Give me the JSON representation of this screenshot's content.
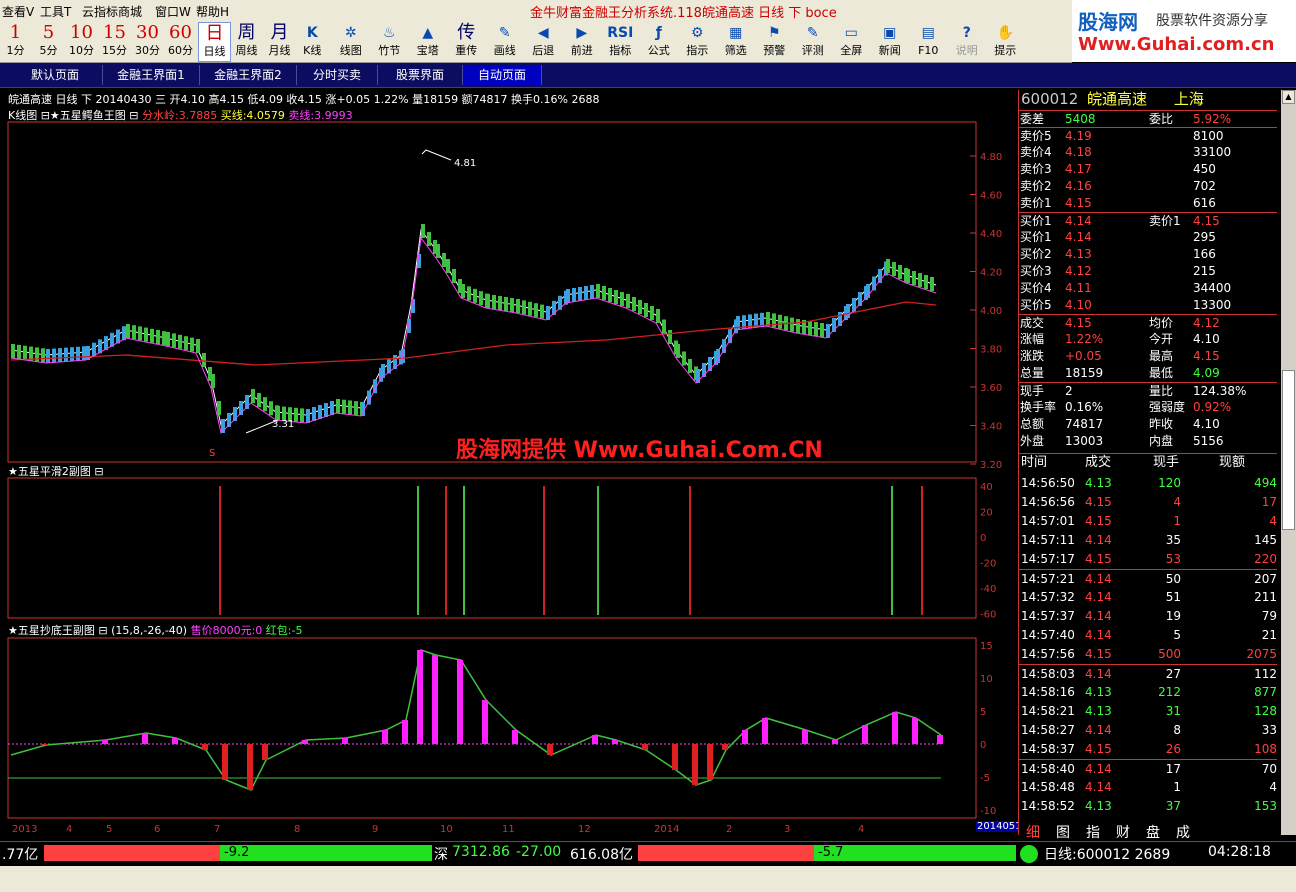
{
  "menu": {
    "items": [
      "查看V",
      "工具T",
      "云指标商城",
      "窗口W",
      "帮助H"
    ],
    "title": "金牛财富金融王分析系统.118皖通高速 日线 下 boce"
  },
  "toolbar": [
    {
      "big": "1",
      "label": "1分"
    },
    {
      "big": "5",
      "label": "5分"
    },
    {
      "big": "10",
      "label": "10分"
    },
    {
      "big": "15",
      "label": "15分"
    },
    {
      "big": "30",
      "label": "30分"
    },
    {
      "big": "60",
      "label": "60分"
    },
    {
      "big": "日",
      "label": "日线"
    },
    {
      "big": "周",
      "label": "周线"
    },
    {
      "big": "月",
      "label": "月线"
    },
    {
      "icon": "K",
      "label": "K线"
    },
    {
      "icon": "✲",
      "label": "线图"
    },
    {
      "icon": "♨",
      "label": "竹节"
    },
    {
      "icon": "▲",
      "label": "宝塔"
    },
    {
      "big": "传",
      "label": "重传"
    },
    {
      "icon": "✎",
      "label": "画线"
    },
    {
      "icon": "◀",
      "label": "后退"
    },
    {
      "icon": "▶",
      "label": "前进"
    },
    {
      "icon": "RSI",
      "label": "指标"
    },
    {
      "icon": "ƒ",
      "label": "公式"
    },
    {
      "icon": "⚙",
      "label": "指示"
    },
    {
      "icon": "▦",
      "label": "筛选"
    },
    {
      "icon": "⚑",
      "label": "预警"
    },
    {
      "icon": "✎",
      "label": "评测"
    },
    {
      "icon": "▭",
      "label": "全屏"
    },
    {
      "icon": "▣",
      "label": "新闻"
    },
    {
      "icon": "▤",
      "label": "F10"
    },
    {
      "icon": "?",
      "label": "说明"
    },
    {
      "icon": "✋",
      "label": "提示"
    }
  ],
  "logo": {
    "line1": "股海网",
    "line2": "股票软件资源分享",
    "line3": "Www.Guhai.com.cn"
  },
  "tabs": [
    "默认页面",
    "金融王界面1",
    "金融王界面2",
    "分时买卖",
    "股票界面",
    "自动页面"
  ],
  "info_bar": "皖通高速  日线  下  20140430  三  开4.10  高4.15  低4.09  收4.15  涨+0.05  1.22%  量18159  额74817  换手0.16%  2688",
  "main_chart": {
    "label": "K线图 ⊟★五星鳄鱼王图 ⊟",
    "indicators": [
      {
        "text": "分水岭:3.7885",
        "color": "#ff4040"
      },
      {
        "text": "买线:4.0579",
        "color": "#ffff40"
      },
      {
        "text": "卖线:3.9993",
        "color": "#ff40ff"
      }
    ],
    "y_ticks": [
      "4.80",
      "4.60",
      "4.40",
      "4.20",
      "4.00",
      "3.80",
      "3.60",
      "3.40",
      "3.20"
    ],
    "high_label": "4.81",
    "low_label": "3.31",
    "sell_mark": "S",
    "watermark": "股海网提供 Www.Guhai.Com.CN"
  },
  "sub_chart1": {
    "label": "★五星平滑2副图 ⊟",
    "y_ticks": [
      "40",
      "20",
      "0",
      "-20",
      "-40",
      "-60"
    ]
  },
  "sub_chart2": {
    "label": "★五星抄底王副图 ⊟ (15,8,-26,-40)",
    "extra": [
      {
        "text": "售价8000元:0",
        "color": "#ff40ff"
      },
      {
        "text": "红包:-5",
        "color": "#40ff40"
      }
    ],
    "y_ticks": [
      "15",
      "10",
      "5",
      "0",
      "-5",
      "-10"
    ]
  },
  "x_axis": [
    "2013",
    "4",
    "5",
    "6",
    "7",
    "8",
    "9",
    "10",
    "11",
    "12",
    "2014",
    "2",
    "3",
    "4"
  ],
  "x_cursor": "2014051",
  "quote": {
    "code": "600012",
    "name": "皖通高速",
    "market": "上海",
    "weicha": "5408",
    "weibi": "5.92%",
    "asks": [
      {
        "l": "卖价5",
        "p": "4.19",
        "v": "8100"
      },
      {
        "l": "卖价4",
        "p": "4.18",
        "v": "33100"
      },
      {
        "l": "卖价3",
        "p": "4.17",
        "v": "450"
      },
      {
        "l": "卖价2",
        "p": "4.16",
        "v": "702"
      },
      {
        "l": "卖价1",
        "p": "4.15",
        "v": "616"
      }
    ],
    "buy1": {
      "l": "买价1",
      "p": "4.14",
      "l2": "卖价1",
      "p2": "4.15"
    },
    "bids": [
      {
        "l": "买价1",
        "p": "4.14",
        "v": "295"
      },
      {
        "l": "买价2",
        "p": "4.13",
        "v": "166"
      },
      {
        "l": "买价3",
        "p": "4.12",
        "v": "215"
      },
      {
        "l": "买价4",
        "p": "4.11",
        "v": "34400"
      },
      {
        "l": "买价5",
        "p": "4.10",
        "v": "13300"
      }
    ],
    "stats": [
      [
        "成交",
        "4.15",
        "均价",
        "4.12"
      ],
      [
        "涨幅",
        "1.22%",
        "今开",
        "4.10"
      ],
      [
        "涨跌",
        "+0.05",
        "最高",
        "4.15"
      ],
      [
        "总量",
        "18159",
        "最低",
        "4.09"
      ],
      [
        "现手",
        "2",
        "量比",
        "124.38%"
      ],
      [
        "换手率",
        "0.16%",
        "强弱度",
        "0.92%"
      ],
      [
        "总额",
        "74817",
        "昨收",
        "4.10"
      ],
      [
        "外盘",
        "13003",
        "内盘",
        "5156"
      ]
    ]
  },
  "ticks_header": [
    "时间",
    "成交",
    "现手",
    "现额"
  ],
  "ticks": [
    [
      "14:56:50",
      "4.13",
      "120",
      "494"
    ],
    [
      "14:56:56",
      "4.15",
      "4",
      "17"
    ],
    [
      "14:57:01",
      "4.15",
      "1",
      "4"
    ],
    [
      "14:57:11",
      "4.14",
      "35",
      "145"
    ],
    [
      "14:57:17",
      "4.15",
      "53",
      "220"
    ],
    [
      "14:57:21",
      "4.14",
      "50",
      "207"
    ],
    [
      "14:57:32",
      "4.14",
      "51",
      "211"
    ],
    [
      "14:57:37",
      "4.14",
      "19",
      "79"
    ],
    [
      "14:57:40",
      "4.14",
      "5",
      "21"
    ],
    [
      "14:57:56",
      "4.15",
      "500",
      "2075"
    ],
    [
      "14:58:03",
      "4.14",
      "27",
      "112"
    ],
    [
      "14:58:16",
      "4.13",
      "212",
      "877"
    ],
    [
      "14:58:21",
      "4.13",
      "31",
      "128"
    ],
    [
      "14:58:27",
      "4.14",
      "8",
      "33"
    ],
    [
      "14:58:37",
      "4.15",
      "26",
      "108"
    ],
    [
      "14:58:40",
      "4.14",
      "17",
      "70"
    ],
    [
      "14:58:48",
      "4.14",
      "1",
      "4"
    ],
    [
      "14:58:52",
      "4.13",
      "37",
      "153"
    ]
  ],
  "panel_tabs": [
    "细",
    "图",
    "指",
    "财",
    "盘",
    "成"
  ],
  "status": {
    "left": ".77亿",
    "left_bar": "-9.2",
    "sz_label": "深",
    "sz_index": "7312.86",
    "sz_chg": "-27.00",
    "sz_amt": "616.08亿",
    "right_bar": "-5.7",
    "code_text": "日线:600012  2689",
    "time": "04:28:18"
  }
}
